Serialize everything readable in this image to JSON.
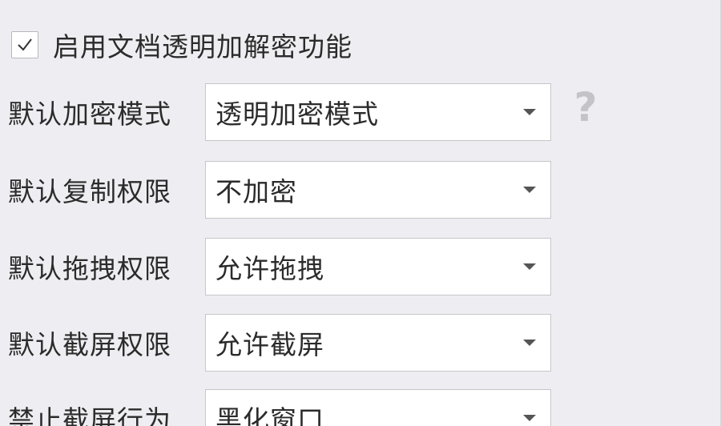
{
  "enable_option": {
    "checked": true,
    "label": "启用文档透明加解密功能"
  },
  "fields": [
    {
      "label": "默认加密模式",
      "value": "透明加密模式"
    },
    {
      "label": "默认复制权限",
      "value": "不加密"
    },
    {
      "label": "默认拖拽权限",
      "value": "允许拖拽"
    },
    {
      "label": "默认截屏权限",
      "value": "允许截屏"
    },
    {
      "label": "禁止截屏行为",
      "value": "黑化窗口"
    }
  ],
  "help_glyph": "?",
  "icons": {
    "checkbox": "checkmark-icon",
    "dropdown": "caret-down-icon",
    "help": "help-icon"
  }
}
